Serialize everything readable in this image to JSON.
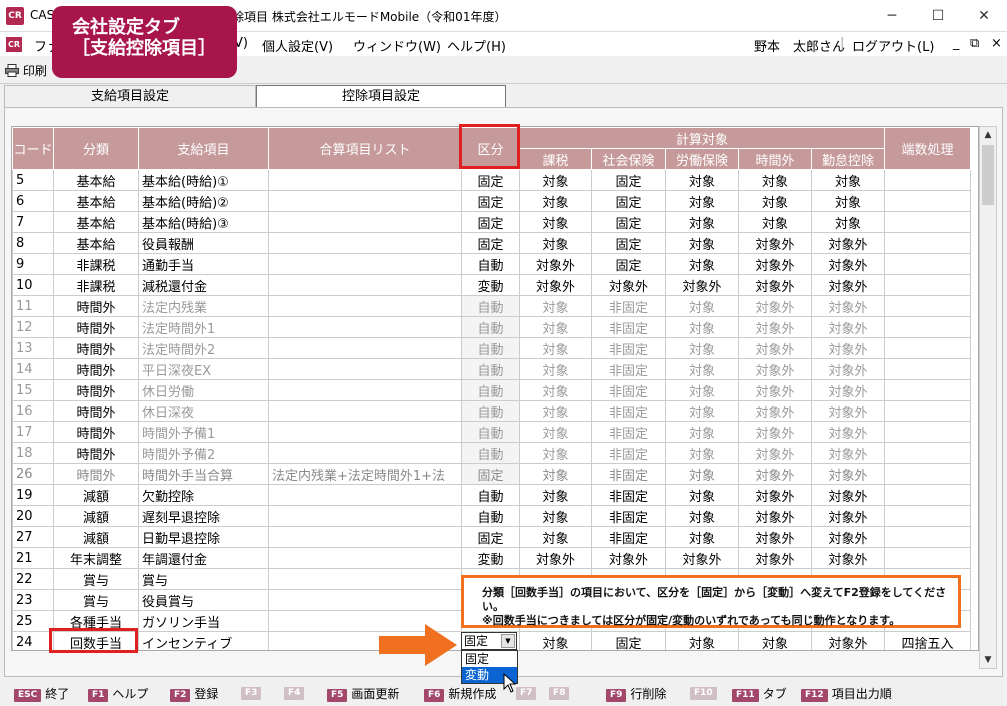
{
  "window": {
    "title_left": "CASH",
    "title_right": "除項目 株式会社エルモードMobile（令和01年度）",
    "minimize": "─",
    "maximize": "☐",
    "close": "✕"
  },
  "menu": {
    "items": [
      "ファ",
      "V)",
      "個人設定(V)",
      "ウィンドウ(W)",
      "ヘルプ(H)"
    ],
    "user": "野本　太郎さん",
    "logout": "ログアウト(L)",
    "mini_controls": [
      "_",
      "⧉",
      "×"
    ]
  },
  "toolbar": {
    "print": "印刷"
  },
  "callout": {
    "line1": "会社設定タブ",
    "line2": "［支給控除項目］"
  },
  "tabs": {
    "active": "支給項目設定",
    "inactive": "控除項目設定"
  },
  "table": {
    "headers": {
      "code": "コード",
      "category": "分類",
      "item": "支給項目",
      "sum_list": "合算項目リスト",
      "kubun": "区分",
      "calc_target": "計算対象",
      "sub": [
        "課税",
        "社会保険",
        "労働保険",
        "時間外",
        "勤怠控除"
      ],
      "rounding": "端数処理"
    },
    "rows": [
      {
        "code": "5",
        "cat": "基本給",
        "item": "基本給(時給)①",
        "sum": "",
        "kubun": "固定",
        "v": [
          "対象",
          "固定",
          "対象",
          "対象",
          "対象"
        ],
        "round": "",
        "style": ""
      },
      {
        "code": "6",
        "cat": "基本給",
        "item": "基本給(時給)②",
        "sum": "",
        "kubun": "固定",
        "v": [
          "対象",
          "固定",
          "対象",
          "対象",
          "対象"
        ],
        "round": "",
        "style": ""
      },
      {
        "code": "7",
        "cat": "基本給",
        "item": "基本給(時給)③",
        "sum": "",
        "kubun": "固定",
        "v": [
          "対象",
          "固定",
          "対象",
          "対象",
          "対象"
        ],
        "round": "",
        "style": ""
      },
      {
        "code": "8",
        "cat": "基本給",
        "item": "役員報酬",
        "sum": "",
        "kubun": "固定",
        "v": [
          "対象",
          "固定",
          "対象",
          "対象外",
          "対象外"
        ],
        "round": "",
        "style": ""
      },
      {
        "code": "9",
        "cat": "非課税",
        "item": "通勤手当",
        "sum": "",
        "kubun": "自動",
        "v": [
          "対象外",
          "固定",
          "対象",
          "対象外",
          "対象外"
        ],
        "round": "",
        "style": ""
      },
      {
        "code": "10",
        "cat": "非課税",
        "item": "減税還付金",
        "sum": "",
        "kubun": "変動",
        "v": [
          "対象外",
          "対象外",
          "対象外",
          "対象外",
          "対象外"
        ],
        "round": "",
        "style": ""
      },
      {
        "code": "11",
        "cat": "時間外",
        "item": "法定内残業",
        "sum": "",
        "kubun": "自動",
        "v": [
          "対象",
          "非固定",
          "対象",
          "対象外",
          "対象外"
        ],
        "round": "",
        "style": "dim"
      },
      {
        "code": "12",
        "cat": "時間外",
        "item": "法定時間外1",
        "sum": "",
        "kubun": "自動",
        "v": [
          "対象",
          "非固定",
          "対象",
          "対象外",
          "対象外"
        ],
        "round": "",
        "style": "dim"
      },
      {
        "code": "13",
        "cat": "時間外",
        "item": "法定時間外2",
        "sum": "",
        "kubun": "自動",
        "v": [
          "対象",
          "非固定",
          "対象",
          "対象外",
          "対象外"
        ],
        "round": "",
        "style": "dim"
      },
      {
        "code": "14",
        "cat": "時間外",
        "item": "平日深夜EX",
        "sum": "",
        "kubun": "自動",
        "v": [
          "対象",
          "非固定",
          "対象",
          "対象外",
          "対象外"
        ],
        "round": "",
        "style": "dim"
      },
      {
        "code": "15",
        "cat": "時間外",
        "item": "休日労働",
        "sum": "",
        "kubun": "自動",
        "v": [
          "対象",
          "非固定",
          "対象",
          "対象外",
          "対象外"
        ],
        "round": "",
        "style": "dim"
      },
      {
        "code": "16",
        "cat": "時間外",
        "item": "休日深夜",
        "sum": "",
        "kubun": "自動",
        "v": [
          "対象",
          "非固定",
          "対象",
          "対象外",
          "対象外"
        ],
        "round": "",
        "style": "dim"
      },
      {
        "code": "17",
        "cat": "時間外",
        "item": "時間外予備1",
        "sum": "",
        "kubun": "自動",
        "v": [
          "対象",
          "非固定",
          "対象",
          "対象外",
          "対象外"
        ],
        "round": "",
        "style": "dim"
      },
      {
        "code": "18",
        "cat": "時間外",
        "item": "時間外予備2",
        "sum": "",
        "kubun": "自動",
        "v": [
          "対象",
          "非固定",
          "対象",
          "対象外",
          "対象外"
        ],
        "round": "",
        "style": "dim"
      },
      {
        "code": "26",
        "cat": "時間外",
        "item": "時間外手当合算",
        "sum": "法定内残業+法定時間外1+法",
        "kubun": "固定",
        "v": [
          "対象",
          "非固定",
          "対象",
          "対象外",
          "対象外"
        ],
        "round": "",
        "style": "dimall"
      },
      {
        "code": "19",
        "cat": "減額",
        "item": "欠勤控除",
        "sum": "",
        "kubun": "自動",
        "v": [
          "対象",
          "非固定",
          "対象",
          "対象外",
          "対象外"
        ],
        "round": "",
        "style": "sub"
      },
      {
        "code": "20",
        "cat": "減額",
        "item": "遅刻早退控除",
        "sum": "",
        "kubun": "自動",
        "v": [
          "対象",
          "非固定",
          "対象",
          "対象外",
          "対象外"
        ],
        "round": "",
        "style": "sub"
      },
      {
        "code": "27",
        "cat": "減額",
        "item": "日勤早退控除",
        "sum": "",
        "kubun": "固定",
        "v": [
          "対象",
          "非固定",
          "対象",
          "対象外",
          "対象外"
        ],
        "round": "",
        "style": "sub"
      },
      {
        "code": "21",
        "cat": "年末調整",
        "item": "年調還付金",
        "sum": "",
        "kubun": "変動",
        "v": [
          "対象外",
          "対象外",
          "対象外",
          "対象外",
          "対象外"
        ],
        "round": "",
        "style": ""
      },
      {
        "code": "22",
        "cat": "賞与",
        "item": "賞与",
        "sum": "",
        "kubun": "",
        "v": [
          "",
          "",
          "",
          "",
          ""
        ],
        "round": "",
        "style": ""
      },
      {
        "code": "23",
        "cat": "賞与",
        "item": "役員賞与",
        "sum": "",
        "kubun": "",
        "v": [
          "",
          "",
          "",
          "",
          ""
        ],
        "round": "",
        "style": ""
      },
      {
        "code": "25",
        "cat": "各種手当",
        "item": "ガソリン手当",
        "sum": "",
        "kubun": "",
        "v": [
          "",
          "",
          "",
          "",
          ""
        ],
        "round": "",
        "style": ""
      },
      {
        "code": "24",
        "cat": "回数手当",
        "item": "インセンティブ",
        "sum": "",
        "kubun": "",
        "v": [
          "対象",
          "固定",
          "対象",
          "対象",
          "対象外"
        ],
        "round": "四捨五入",
        "style": ""
      }
    ]
  },
  "note": {
    "line1": "分類［回数手当］の項目において、区分を［固定］から［変動］へ変えてF2登録をしてください。",
    "line2": "※回数手当につきましては区分が固定/変動のいずれであっても同じ動作となります。"
  },
  "dropdown": {
    "value": "固定",
    "options": [
      "固定",
      "変動"
    ],
    "highlighted": "変動"
  },
  "fnkeys": [
    {
      "key": "ESC",
      "label": "終了",
      "enabled": true
    },
    {
      "key": "F1",
      "label": "ヘルプ",
      "enabled": true
    },
    {
      "key": "F2",
      "label": "登録",
      "enabled": true
    },
    {
      "key": "F3",
      "label": "",
      "enabled": false
    },
    {
      "key": "F4",
      "label": "",
      "enabled": false
    },
    {
      "key": "F5",
      "label": "画面更新",
      "enabled": true
    },
    {
      "key": "F6",
      "label": "新規作成",
      "enabled": true
    },
    {
      "key": "F7",
      "label": "",
      "enabled": false
    },
    {
      "key": "F8",
      "label": "",
      "enabled": false
    },
    {
      "key": "F9",
      "label": "行削除",
      "enabled": true
    },
    {
      "key": "F10",
      "label": "",
      "enabled": false
    },
    {
      "key": "F11",
      "label": "タブ",
      "enabled": true
    },
    {
      "key": "F12",
      "label": "項目出力順",
      "enabled": true
    }
  ],
  "colors": {
    "header_bg": "#c69a9a",
    "accent": "#a8154a",
    "highlight_box": "#e02020",
    "note_border": "#f07020",
    "selection": "#0a64d2"
  }
}
